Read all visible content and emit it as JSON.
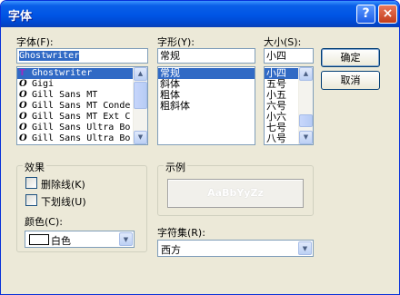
{
  "window": {
    "title": "字体",
    "help_glyph": "?",
    "close_glyph": "×"
  },
  "font": {
    "label": "字体(F):",
    "value": "Ghostwriter",
    "items": [
      "Ghostwriter",
      "Gigi",
      "Gill Sans MT",
      "Gill Sans MT Conde",
      "Gill Sans MT Ext C",
      "Gill Sans Ultra Bo",
      "Gill Sans Ultra Bo"
    ],
    "icons": [
      "tt-font-icon",
      "opentype-font-icon",
      "opentype-font-icon",
      "opentype-font-icon",
      "opentype-font-icon",
      "opentype-font-icon",
      "opentype-font-icon"
    ]
  },
  "style": {
    "label": "字形(Y):",
    "value": "常规",
    "items": [
      "常规",
      "斜体",
      "粗体",
      "粗斜体"
    ]
  },
  "size": {
    "label": "大小(S):",
    "value": "小四",
    "items": [
      "小四",
      "五号",
      "小五",
      "六号",
      "小六",
      "七号",
      "八号"
    ]
  },
  "buttons": {
    "ok": "确定",
    "cancel": "取消"
  },
  "effects": {
    "title": "效果",
    "strikeout": "删除线(K)",
    "underline": "下划线(U)",
    "color_label": "颜色(C):",
    "color_value": "白色",
    "color_swatch": "#ffffff"
  },
  "sample": {
    "title": "示例",
    "text": "AaBbYyZz"
  },
  "script": {
    "label": "字符集(R):",
    "value": "西方"
  },
  "colors": {
    "selection": "#316ac5",
    "titlebar": "#0055e5",
    "face": "#ece9d8"
  }
}
